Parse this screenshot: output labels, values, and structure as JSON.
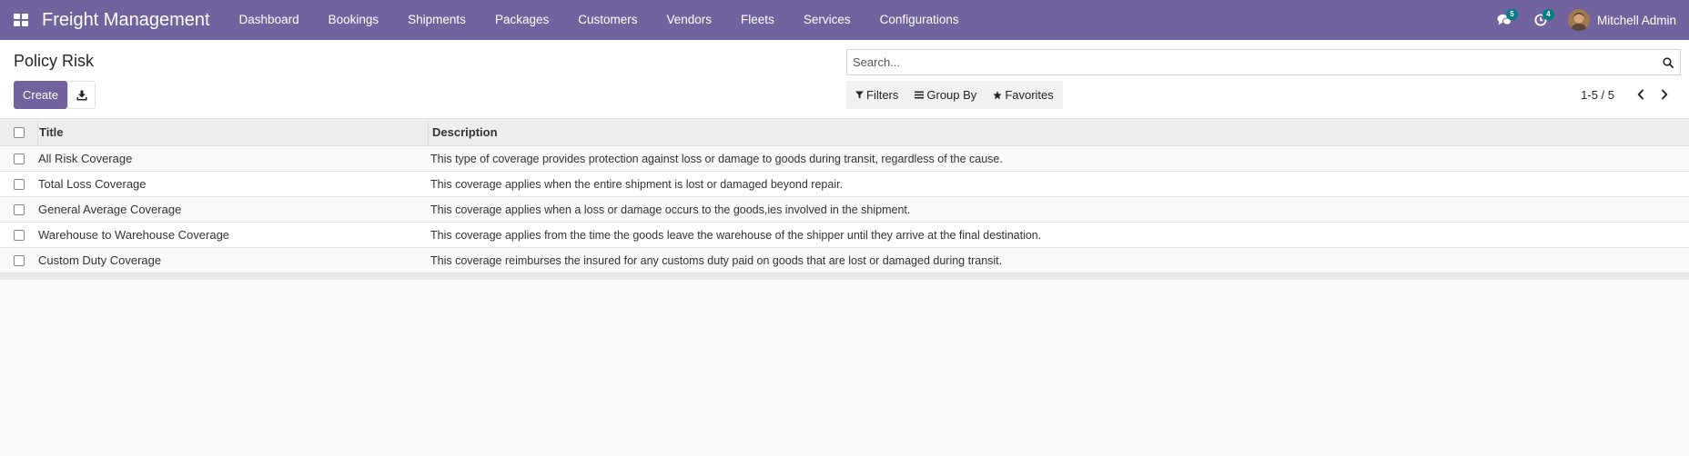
{
  "navbar": {
    "brand": "Freight Management",
    "menu": [
      "Dashboard",
      "Bookings",
      "Shipments",
      "Packages",
      "Customers",
      "Vendors",
      "Fleets",
      "Services",
      "Configurations"
    ],
    "messages_count": "5",
    "activities_count": "4",
    "user_name": "Mitchell Admin",
    "bar_color": "#71639e",
    "badge_color": "#017e84"
  },
  "control_panel": {
    "title": "Policy Risk",
    "create_label": "Create",
    "search_placeholder": "Search...",
    "filters_label": "Filters",
    "group_by_label": "Group By",
    "favorites_label": "Favorites",
    "pager_value": "1-5 / 5"
  },
  "list": {
    "columns": [
      "Title",
      "Description"
    ],
    "rows": [
      {
        "title": "All Risk Coverage",
        "description": "This type of coverage provides protection against loss or damage to goods during transit, regardless of the cause."
      },
      {
        "title": "Total Loss Coverage",
        "description": "This coverage applies when the entire shipment is lost or damaged beyond repair."
      },
      {
        "title": "General Average Coverage",
        "description": "This coverage applies when a loss or damage occurs to the goods,ies involved in the shipment."
      },
      {
        "title": "Warehouse to Warehouse Coverage",
        "description": "This coverage applies from the time the goods leave the warehouse of the shipper until they arrive at the final destination."
      },
      {
        "title": "Custom Duty Coverage",
        "description": "This coverage reimburses the insured for any customs duty paid on goods that are lost or damaged during transit."
      }
    ]
  },
  "icons": {
    "apps": "apps-grid-icon",
    "messages": "chat-bubbles-icon",
    "activities": "clock-icon",
    "download": "download-icon",
    "search": "magnifier-icon",
    "filters": "funnel-icon",
    "group_by": "list-bars-icon",
    "favorites": "star-icon",
    "prev": "chevron-left-icon",
    "next": "chevron-right-icon"
  }
}
